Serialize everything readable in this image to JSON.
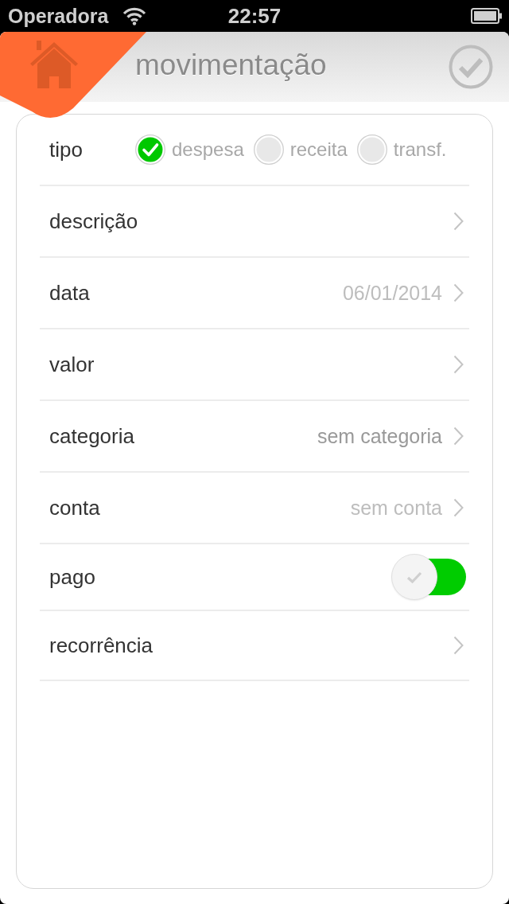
{
  "status_bar": {
    "carrier": "Operadora",
    "time": "22:57"
  },
  "header": {
    "title": "movimentação"
  },
  "rows": [
    {
      "kind": "radio",
      "label": "tipo",
      "options": [
        {
          "label": "despesa",
          "selected": true
        },
        {
          "label": "receita",
          "selected": false
        },
        {
          "label": "transf.",
          "selected": false
        }
      ]
    },
    {
      "kind": "link",
      "label": "descrição"
    },
    {
      "kind": "link",
      "label": "data",
      "value": "06/01/2014",
      "dimmed": true
    },
    {
      "kind": "link",
      "label": "valor"
    },
    {
      "kind": "link",
      "label": "categoria",
      "value": "sem categoria",
      "dimmed": false
    },
    {
      "kind": "link",
      "label": "conta",
      "value": "sem conta",
      "dimmed": true
    },
    {
      "kind": "toggle",
      "label": "pago",
      "on": true
    },
    {
      "kind": "link",
      "label": "recorrência"
    }
  ]
}
